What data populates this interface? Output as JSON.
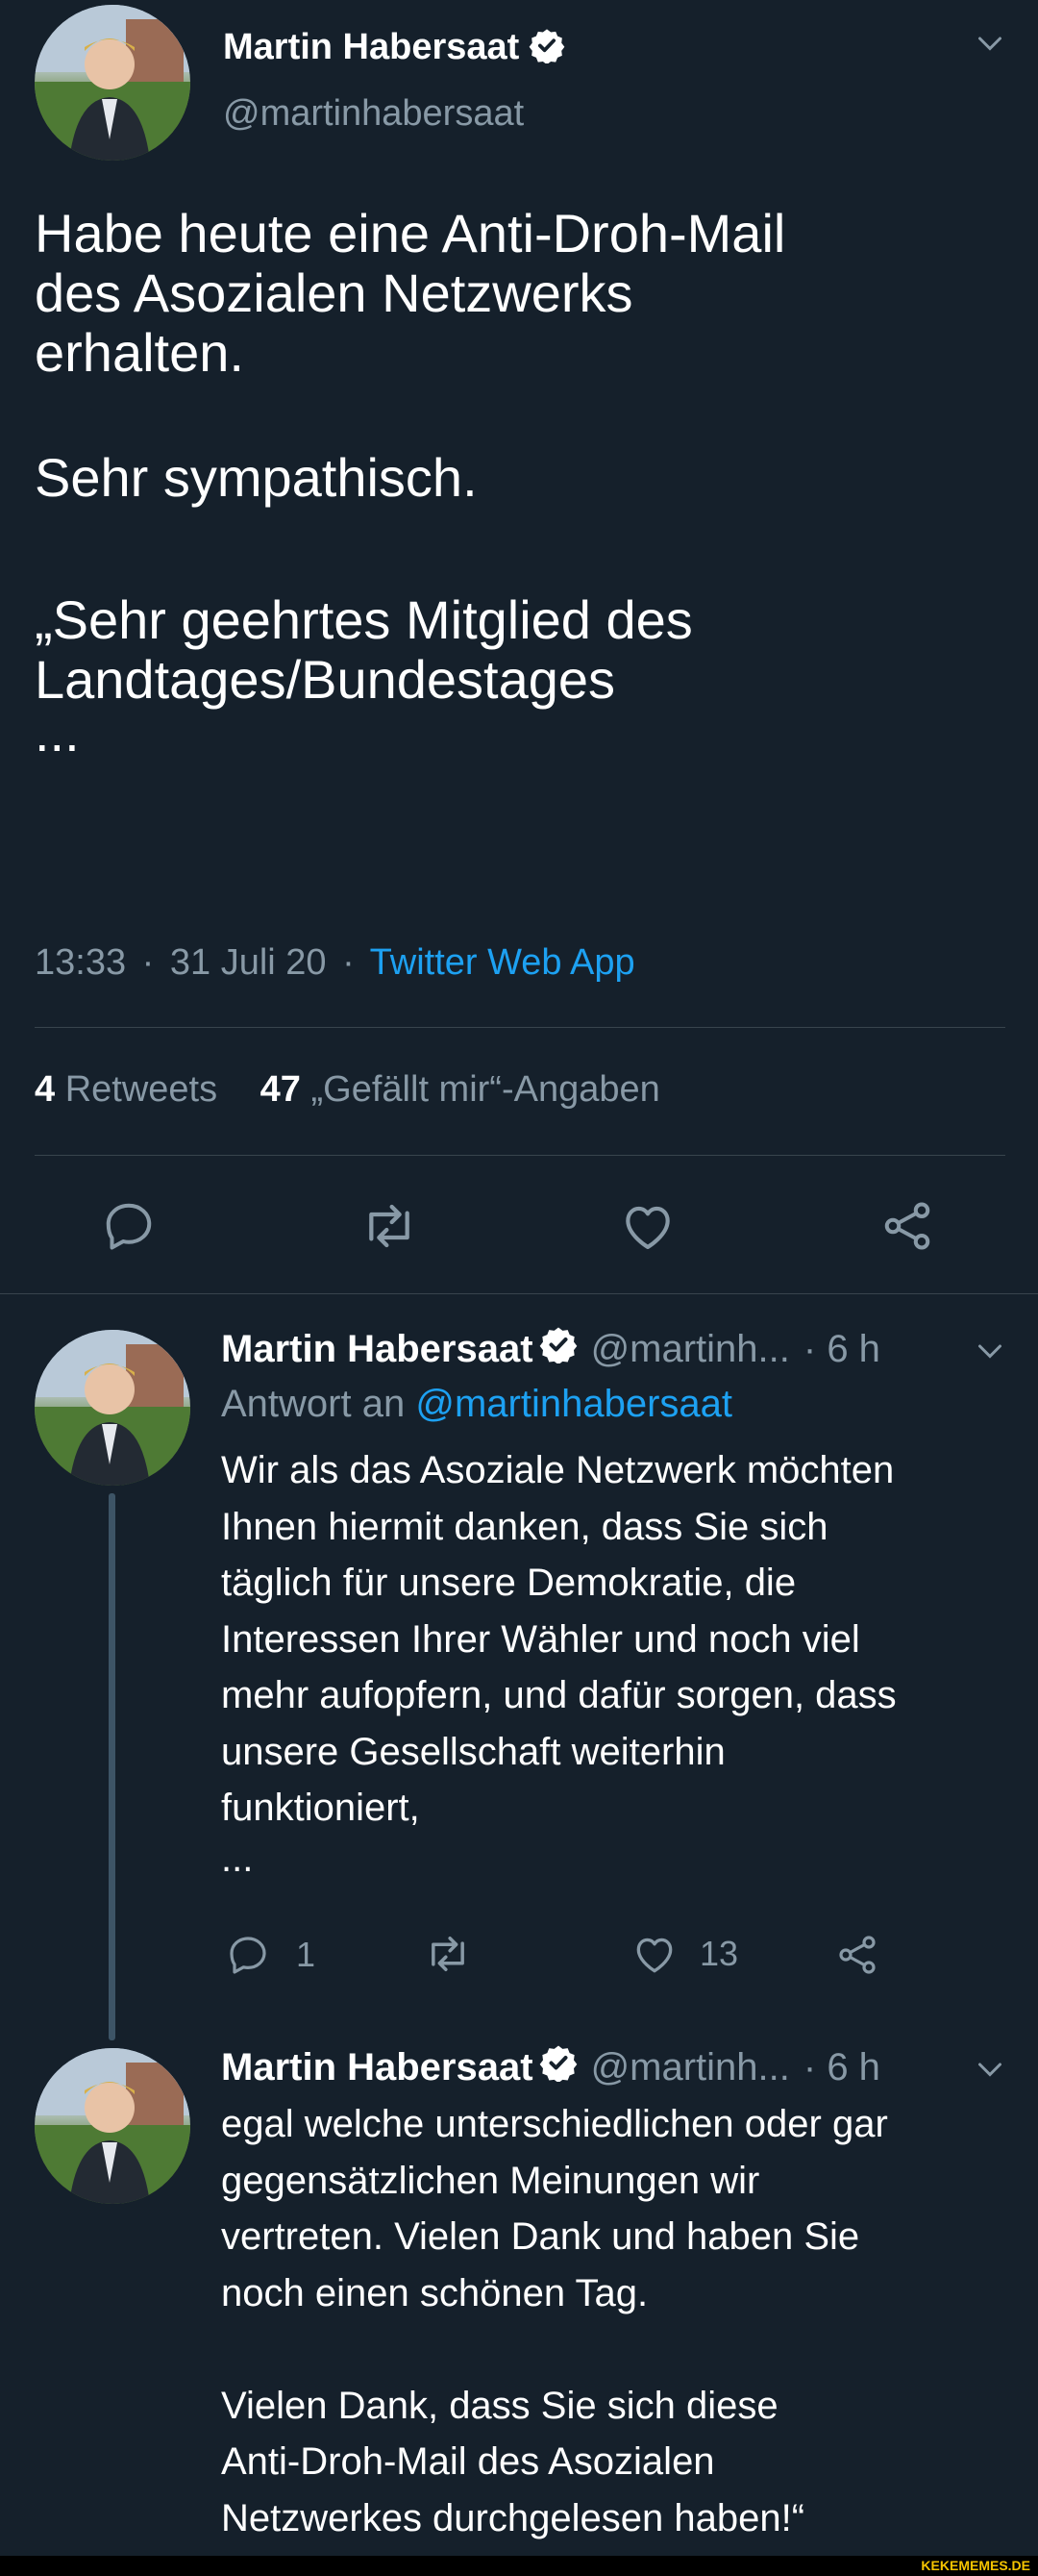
{
  "main_tweet": {
    "author_name": "Martin Habersaat",
    "handle": "@martinhabersaat",
    "text_lines": [
      "Habe heute eine Anti-Droh-Mail",
      "des Asozialen Netzwerks",
      "erhalten.",
      "",
      "Sehr sympathisch.",
      "",
      "„Sehr geehrtes Mitglied des",
      "Landtages/Bundestages",
      "..."
    ],
    "time": "13:33",
    "date": "31 Juli 20",
    "separator": "·",
    "source": "Twitter Web App",
    "retweets_count": "4",
    "retweets_label": "Retweets",
    "likes_count": "47",
    "likes_label": "„Gefällt mir“-Angaben"
  },
  "reply1": {
    "author_name": "Martin Habersaat",
    "handle": "@martinh...",
    "time": "· 6 h",
    "reply_prefix": "Antwort an",
    "reply_to": "@martinhabersaat",
    "text_lines": [
      "Wir als das Asoziale Netzwerk möchten",
      "Ihnen hiermit danken, dass Sie sich",
      "täglich für unsere Demokratie, die",
      "Interessen Ihrer Wähler und noch viel",
      "mehr aufopfern, und dafür sorgen, dass",
      "unsere Gesellschaft weiterhin",
      "funktioniert,",
      "..."
    ],
    "reply_count": "1",
    "like_count": "13"
  },
  "reply2": {
    "author_name": "Martin Habersaat",
    "handle": "@martinh...",
    "time": "· 6 h",
    "text_lines": [
      "egal welche unterschiedlichen oder gar",
      "gegensätzlichen Meinungen wir",
      "vertreten. Vielen Dank und haben Sie",
      "noch einen schönen Tag.",
      "",
      "Vielen Dank, dass Sie sich diese",
      "Anti-Droh-Mail des Asozialen",
      "Netzwerkes durchgelesen haben!“"
    ]
  },
  "watermark": "KEKEMEMES.DE",
  "colors": {
    "background": "#15202b",
    "muted": "#8899a6",
    "link": "#1da1f2",
    "divider": "#38444d"
  }
}
